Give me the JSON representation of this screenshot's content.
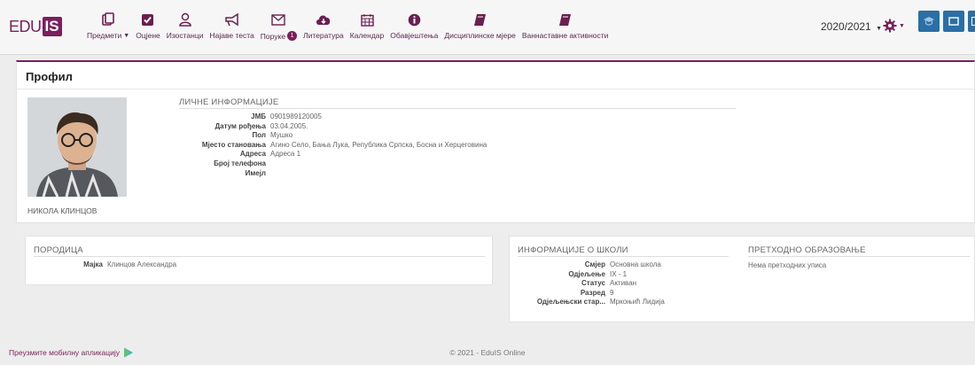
{
  "header": {
    "logo_edu": "EDU",
    "logo_is": "IS",
    "nav": [
      {
        "label": "Предмети",
        "icon": "subjects-icon",
        "dropdown": true
      },
      {
        "label": "Оцјене",
        "icon": "grades-check-icon"
      },
      {
        "label": "Изостанци",
        "icon": "absences-person-icon"
      },
      {
        "label": "Најаве теста",
        "icon": "megaphone-icon"
      },
      {
        "label": "Поруке",
        "icon": "envelope-icon",
        "badge": "1"
      },
      {
        "label": "Литература",
        "icon": "cloud-download-icon"
      },
      {
        "label": "Календар",
        "icon": "calendar-icon"
      },
      {
        "label": "Обавјештења",
        "icon": "info-icon"
      },
      {
        "label": "Дисциплинске мјере",
        "icon": "book-icon"
      },
      {
        "label": "Ваннаставне активности",
        "icon": "book-icon"
      }
    ],
    "year": "2020/2021",
    "accent": "#7a1f5c",
    "button_blue": "#2a6fa5"
  },
  "profile": {
    "title": "Профил",
    "student_name": "НИКОЛА КЛИНЦОВ",
    "personal_heading": "ЛИЧНЕ ИНФОРМАЦИЈЕ",
    "personal": [
      {
        "key": "ЈМБ",
        "value": "0901989120005"
      },
      {
        "key": "Датум рођења",
        "value": "03.04.2005."
      },
      {
        "key": "Пол",
        "value": "Мушко"
      },
      {
        "key": "Мјесто становања",
        "value": "Агино Село, Бања Лука, Република Српска, Босна и Херцеговина"
      },
      {
        "key": "Адреса",
        "value": "Адреса 1"
      },
      {
        "key": "Број телефона",
        "value": ""
      },
      {
        "key": "Имејл",
        "value": ""
      }
    ]
  },
  "family": {
    "heading": "ПОРОДИЦА",
    "rows": [
      {
        "key": "Мајка",
        "value": "Клинцов Александра"
      }
    ]
  },
  "school": {
    "heading": "ИНФОРМАЦИЈЕ О ШКОЛИ",
    "rows": [
      {
        "key": "Смјер",
        "value": "Основна школа"
      },
      {
        "key": "Одјељење",
        "value": "IX - 1"
      },
      {
        "key": "Статус",
        "value": "Активан"
      },
      {
        "key": "Разред",
        "value": "9"
      },
      {
        "key": "Одјељењски стар...",
        "value": "Мркоњић Лидија"
      }
    ],
    "prev_heading": "ПРЕТХОДНО ОБРАЗОВАЊЕ",
    "prev_text": "Нема претходних уписа"
  },
  "footer": {
    "app_link": "Преузмите мобилну апликацију",
    "copyright": "© 2021 - EduIS Online"
  }
}
